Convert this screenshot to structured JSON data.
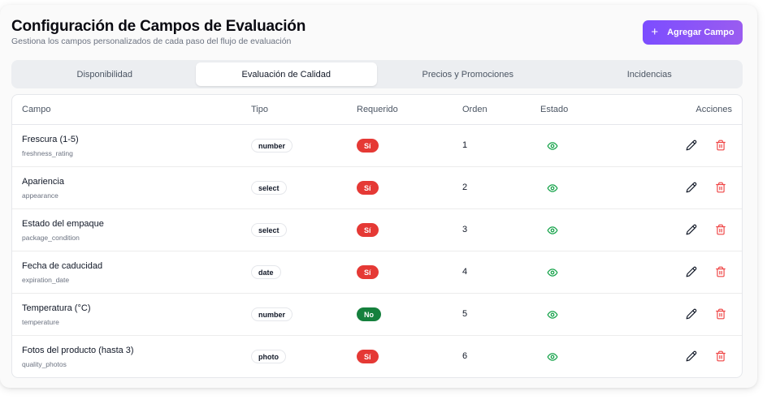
{
  "header": {
    "title": "Configuración de Campos de Evaluación",
    "subtitle": "Gestiona los campos personalizados de cada paso del flujo de evaluación",
    "add_button_label": "Agregar Campo",
    "add_button_icon": "plus-icon"
  },
  "tabs": [
    {
      "label": "Disponibilidad",
      "active": false
    },
    {
      "label": "Evaluación de Calidad",
      "active": true
    },
    {
      "label": "Precios y Promociones",
      "active": false
    },
    {
      "label": "Incidencias",
      "active": false
    }
  ],
  "table": {
    "columns": [
      "Campo",
      "Tipo",
      "Requerido",
      "Orden",
      "Estado",
      "Acciones"
    ],
    "rows": [
      {
        "name": "Frescura (1-5)",
        "key": "freshness_rating",
        "type": "number",
        "required": "Sí",
        "order": "1",
        "status_icon": "eye-icon"
      },
      {
        "name": "Apariencia",
        "key": "appearance",
        "type": "select",
        "required": "Sí",
        "order": "2",
        "status_icon": "eye-icon"
      },
      {
        "name": "Estado del empaque",
        "key": "package_condition",
        "type": "select",
        "required": "Sí",
        "order": "3",
        "status_icon": "eye-icon"
      },
      {
        "name": "Fecha de caducidad",
        "key": "expiration_date",
        "type": "date",
        "required": "Sí",
        "order": "4",
        "status_icon": "eye-icon"
      },
      {
        "name": "Temperatura (°C)",
        "key": "temperature",
        "type": "number",
        "required": "No",
        "order": "5",
        "status_icon": "eye-icon"
      },
      {
        "name": "Fotos del producto (hasta 3)",
        "key": "quality_photos",
        "type": "photo",
        "required": "Sí",
        "order": "6",
        "status_icon": "eye-icon"
      }
    ]
  },
  "colors": {
    "accent": "#8352f8",
    "required_yes": "#e53935",
    "required_no": "#15803d",
    "status_visible": "#16a34a",
    "delete_icon": "#ef4444",
    "edit_icon": "#111827"
  }
}
